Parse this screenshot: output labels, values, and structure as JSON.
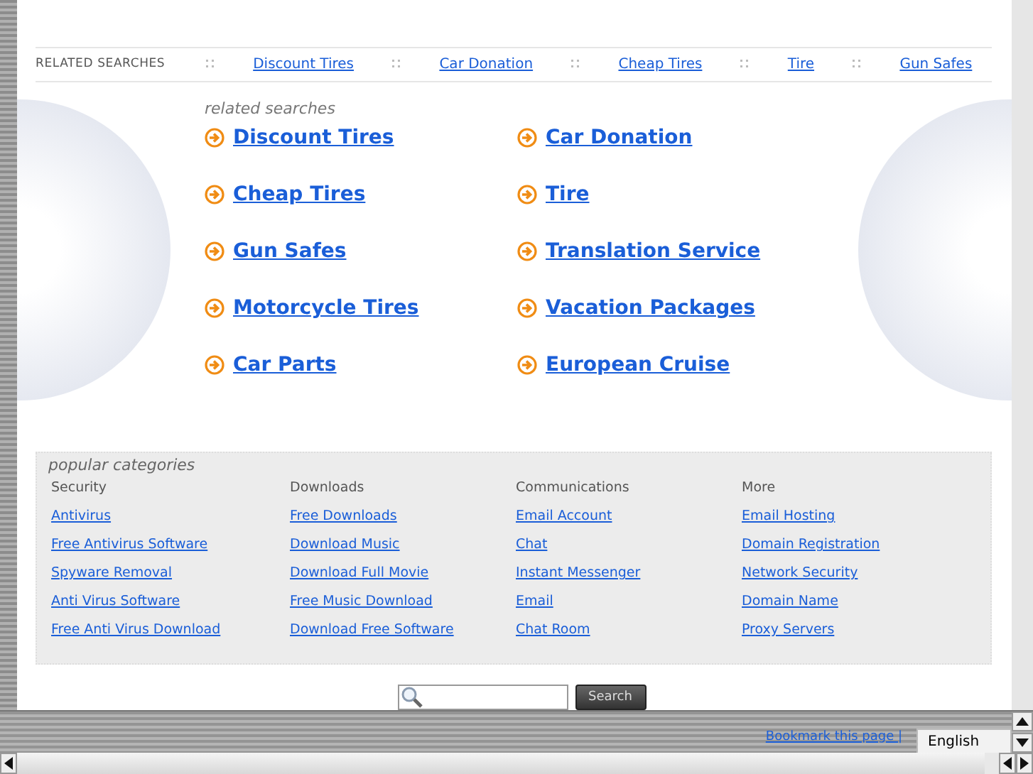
{
  "related_bar": {
    "label": "RELATED SEARCHES",
    "links": [
      "Discount Tires",
      "Car Donation",
      "Cheap Tires",
      "Tire",
      "Gun Safes"
    ]
  },
  "related_searches": {
    "heading": "related searches",
    "links": [
      "Discount Tires",
      "Car Donation",
      "Cheap Tires",
      "Tire",
      "Gun Safes",
      "Translation Service",
      "Motorcycle Tires",
      "Vacation Packages",
      "Car Parts",
      "European Cruise"
    ]
  },
  "popular_categories": {
    "heading": "popular categories",
    "columns": [
      {
        "title": "Security",
        "links": [
          "Antivirus",
          "Free Antivirus Software",
          "Spyware Removal",
          "Anti Virus Software",
          "Free Anti Virus Download"
        ]
      },
      {
        "title": "Downloads",
        "links": [
          "Free Downloads",
          "Download Music",
          "Download Full Movie",
          "Free Music Download",
          "Download Free Software"
        ]
      },
      {
        "title": "Communications",
        "links": [
          "Email Account",
          "Chat",
          "Instant Messenger",
          "Email",
          "Chat Room"
        ]
      },
      {
        "title": "More",
        "links": [
          "Email Hosting",
          "Domain Registration",
          "Network Security",
          "Domain Name",
          "Proxy Servers"
        ]
      }
    ]
  },
  "search": {
    "button": "Search"
  },
  "footer": {
    "bookmark": "Bookmark this page |",
    "language": "English"
  }
}
